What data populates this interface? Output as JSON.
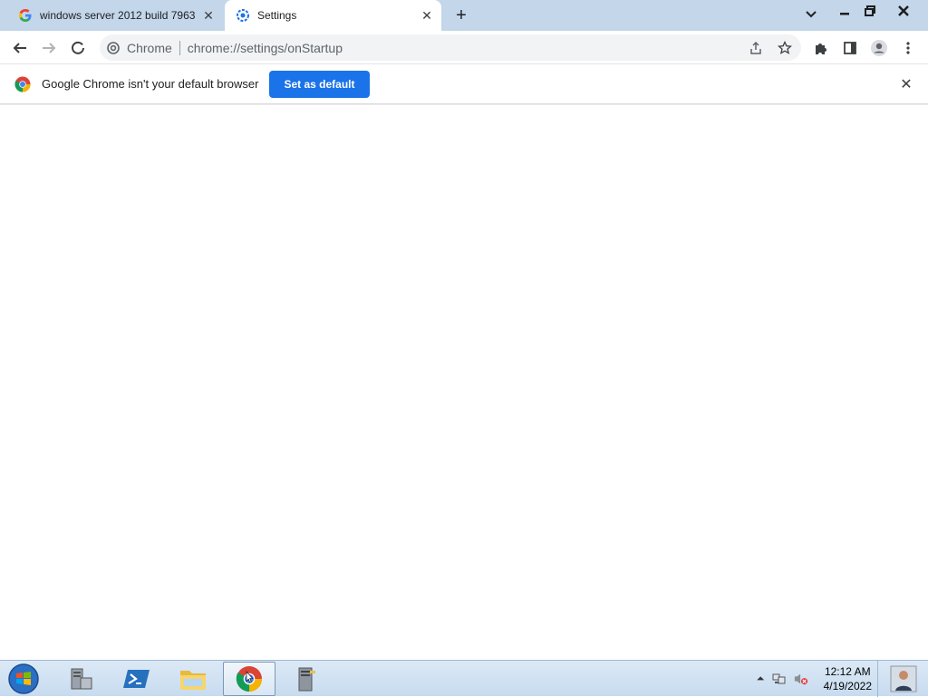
{
  "tabs": [
    {
      "title": "windows server 2012 build 7963",
      "favicon": "google-g-icon",
      "close": "✕"
    },
    {
      "title": "Settings",
      "favicon": "chrome-settings-gear-icon",
      "close": "✕"
    }
  ],
  "new_tab_label": "+",
  "window_controls": {
    "dropdown": "⌄",
    "minimize": "—",
    "restore": "❐",
    "close": "✕"
  },
  "omnibox": {
    "origin_label": "Chrome",
    "url": "chrome://settings/onStartup"
  },
  "infobar": {
    "message": "Google Chrome isn't your default browser",
    "button_label": "Set as default",
    "close": "✕"
  },
  "taskbar": {
    "items": [
      "server-manager-icon",
      "powershell-icon",
      "file-explorer-icon",
      "chrome-icon",
      "server-tools-icon"
    ],
    "active_item": "chrome-icon",
    "clock_time": "12:12 AM",
    "clock_date": "4/19/2022",
    "tray_arrow": "⏶"
  },
  "colors": {
    "tabstrip": "#c3d6ea",
    "accent": "#1a73e8",
    "taskbar": "#c7dbef"
  }
}
